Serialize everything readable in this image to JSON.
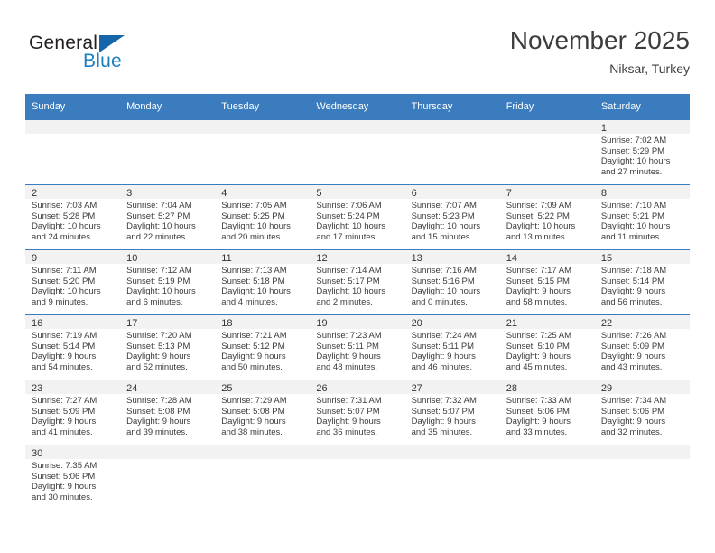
{
  "brand": {
    "word1": "General",
    "word2": "Blue",
    "flag_icon": "triangle-flag-icon",
    "color_dark": "#231f20",
    "color_blue": "#1b7fc4"
  },
  "header": {
    "month_title": "November 2025",
    "location": "Niksar, Turkey"
  },
  "theme": {
    "header_bg": "#3a7cbe",
    "cell_head_bg": "#f2f2f2",
    "grid_line": "#3a7cbe",
    "text": "#3b3b3b"
  },
  "weekday_headers": [
    "Sunday",
    "Monday",
    "Tuesday",
    "Wednesday",
    "Thursday",
    "Friday",
    "Saturday"
  ],
  "weeks": [
    [
      {
        "day": "",
        "sunrise": "",
        "sunset": "",
        "daylight1": "",
        "daylight2": "",
        "empty": true
      },
      {
        "day": "",
        "sunrise": "",
        "sunset": "",
        "daylight1": "",
        "daylight2": "",
        "empty": true
      },
      {
        "day": "",
        "sunrise": "",
        "sunset": "",
        "daylight1": "",
        "daylight2": "",
        "empty": true
      },
      {
        "day": "",
        "sunrise": "",
        "sunset": "",
        "daylight1": "",
        "daylight2": "",
        "empty": true
      },
      {
        "day": "",
        "sunrise": "",
        "sunset": "",
        "daylight1": "",
        "daylight2": "",
        "empty": true
      },
      {
        "day": "",
        "sunrise": "",
        "sunset": "",
        "daylight1": "",
        "daylight2": "",
        "empty": true
      },
      {
        "day": "1",
        "sunrise": "Sunrise: 7:02 AM",
        "sunset": "Sunset: 5:29 PM",
        "daylight1": "Daylight: 10 hours",
        "daylight2": "and 27 minutes.",
        "empty": false
      }
    ],
    [
      {
        "day": "2",
        "sunrise": "Sunrise: 7:03 AM",
        "sunset": "Sunset: 5:28 PM",
        "daylight1": "Daylight: 10 hours",
        "daylight2": "and 24 minutes.",
        "empty": false
      },
      {
        "day": "3",
        "sunrise": "Sunrise: 7:04 AM",
        "sunset": "Sunset: 5:27 PM",
        "daylight1": "Daylight: 10 hours",
        "daylight2": "and 22 minutes.",
        "empty": false
      },
      {
        "day": "4",
        "sunrise": "Sunrise: 7:05 AM",
        "sunset": "Sunset: 5:25 PM",
        "daylight1": "Daylight: 10 hours",
        "daylight2": "and 20 minutes.",
        "empty": false
      },
      {
        "day": "5",
        "sunrise": "Sunrise: 7:06 AM",
        "sunset": "Sunset: 5:24 PM",
        "daylight1": "Daylight: 10 hours",
        "daylight2": "and 17 minutes.",
        "empty": false
      },
      {
        "day": "6",
        "sunrise": "Sunrise: 7:07 AM",
        "sunset": "Sunset: 5:23 PM",
        "daylight1": "Daylight: 10 hours",
        "daylight2": "and 15 minutes.",
        "empty": false
      },
      {
        "day": "7",
        "sunrise": "Sunrise: 7:09 AM",
        "sunset": "Sunset: 5:22 PM",
        "daylight1": "Daylight: 10 hours",
        "daylight2": "and 13 minutes.",
        "empty": false
      },
      {
        "day": "8",
        "sunrise": "Sunrise: 7:10 AM",
        "sunset": "Sunset: 5:21 PM",
        "daylight1": "Daylight: 10 hours",
        "daylight2": "and 11 minutes.",
        "empty": false
      }
    ],
    [
      {
        "day": "9",
        "sunrise": "Sunrise: 7:11 AM",
        "sunset": "Sunset: 5:20 PM",
        "daylight1": "Daylight: 10 hours",
        "daylight2": "and 9 minutes.",
        "empty": false
      },
      {
        "day": "10",
        "sunrise": "Sunrise: 7:12 AM",
        "sunset": "Sunset: 5:19 PM",
        "daylight1": "Daylight: 10 hours",
        "daylight2": "and 6 minutes.",
        "empty": false
      },
      {
        "day": "11",
        "sunrise": "Sunrise: 7:13 AM",
        "sunset": "Sunset: 5:18 PM",
        "daylight1": "Daylight: 10 hours",
        "daylight2": "and 4 minutes.",
        "empty": false
      },
      {
        "day": "12",
        "sunrise": "Sunrise: 7:14 AM",
        "sunset": "Sunset: 5:17 PM",
        "daylight1": "Daylight: 10 hours",
        "daylight2": "and 2 minutes.",
        "empty": false
      },
      {
        "day": "13",
        "sunrise": "Sunrise: 7:16 AM",
        "sunset": "Sunset: 5:16 PM",
        "daylight1": "Daylight: 10 hours",
        "daylight2": "and 0 minutes.",
        "empty": false
      },
      {
        "day": "14",
        "sunrise": "Sunrise: 7:17 AM",
        "sunset": "Sunset: 5:15 PM",
        "daylight1": "Daylight: 9 hours",
        "daylight2": "and 58 minutes.",
        "empty": false
      },
      {
        "day": "15",
        "sunrise": "Sunrise: 7:18 AM",
        "sunset": "Sunset: 5:14 PM",
        "daylight1": "Daylight: 9 hours",
        "daylight2": "and 56 minutes.",
        "empty": false
      }
    ],
    [
      {
        "day": "16",
        "sunrise": "Sunrise: 7:19 AM",
        "sunset": "Sunset: 5:14 PM",
        "daylight1": "Daylight: 9 hours",
        "daylight2": "and 54 minutes.",
        "empty": false
      },
      {
        "day": "17",
        "sunrise": "Sunrise: 7:20 AM",
        "sunset": "Sunset: 5:13 PM",
        "daylight1": "Daylight: 9 hours",
        "daylight2": "and 52 minutes.",
        "empty": false
      },
      {
        "day": "18",
        "sunrise": "Sunrise: 7:21 AM",
        "sunset": "Sunset: 5:12 PM",
        "daylight1": "Daylight: 9 hours",
        "daylight2": "and 50 minutes.",
        "empty": false
      },
      {
        "day": "19",
        "sunrise": "Sunrise: 7:23 AM",
        "sunset": "Sunset: 5:11 PM",
        "daylight1": "Daylight: 9 hours",
        "daylight2": "and 48 minutes.",
        "empty": false
      },
      {
        "day": "20",
        "sunrise": "Sunrise: 7:24 AM",
        "sunset": "Sunset: 5:11 PM",
        "daylight1": "Daylight: 9 hours",
        "daylight2": "and 46 minutes.",
        "empty": false
      },
      {
        "day": "21",
        "sunrise": "Sunrise: 7:25 AM",
        "sunset": "Sunset: 5:10 PM",
        "daylight1": "Daylight: 9 hours",
        "daylight2": "and 45 minutes.",
        "empty": false
      },
      {
        "day": "22",
        "sunrise": "Sunrise: 7:26 AM",
        "sunset": "Sunset: 5:09 PM",
        "daylight1": "Daylight: 9 hours",
        "daylight2": "and 43 minutes.",
        "empty": false
      }
    ],
    [
      {
        "day": "23",
        "sunrise": "Sunrise: 7:27 AM",
        "sunset": "Sunset: 5:09 PM",
        "daylight1": "Daylight: 9 hours",
        "daylight2": "and 41 minutes.",
        "empty": false
      },
      {
        "day": "24",
        "sunrise": "Sunrise: 7:28 AM",
        "sunset": "Sunset: 5:08 PM",
        "daylight1": "Daylight: 9 hours",
        "daylight2": "and 39 minutes.",
        "empty": false
      },
      {
        "day": "25",
        "sunrise": "Sunrise: 7:29 AM",
        "sunset": "Sunset: 5:08 PM",
        "daylight1": "Daylight: 9 hours",
        "daylight2": "and 38 minutes.",
        "empty": false
      },
      {
        "day": "26",
        "sunrise": "Sunrise: 7:31 AM",
        "sunset": "Sunset: 5:07 PM",
        "daylight1": "Daylight: 9 hours",
        "daylight2": "and 36 minutes.",
        "empty": false
      },
      {
        "day": "27",
        "sunrise": "Sunrise: 7:32 AM",
        "sunset": "Sunset: 5:07 PM",
        "daylight1": "Daylight: 9 hours",
        "daylight2": "and 35 minutes.",
        "empty": false
      },
      {
        "day": "28",
        "sunrise": "Sunrise: 7:33 AM",
        "sunset": "Sunset: 5:06 PM",
        "daylight1": "Daylight: 9 hours",
        "daylight2": "and 33 minutes.",
        "empty": false
      },
      {
        "day": "29",
        "sunrise": "Sunrise: 7:34 AM",
        "sunset": "Sunset: 5:06 PM",
        "daylight1": "Daylight: 9 hours",
        "daylight2": "and 32 minutes.",
        "empty": false
      }
    ],
    [
      {
        "day": "30",
        "sunrise": "Sunrise: 7:35 AM",
        "sunset": "Sunset: 5:06 PM",
        "daylight1": "Daylight: 9 hours",
        "daylight2": "and 30 minutes.",
        "empty": false
      },
      {
        "day": "",
        "sunrise": "",
        "sunset": "",
        "daylight1": "",
        "daylight2": "",
        "empty": true
      },
      {
        "day": "",
        "sunrise": "",
        "sunset": "",
        "daylight1": "",
        "daylight2": "",
        "empty": true
      },
      {
        "day": "",
        "sunrise": "",
        "sunset": "",
        "daylight1": "",
        "daylight2": "",
        "empty": true
      },
      {
        "day": "",
        "sunrise": "",
        "sunset": "",
        "daylight1": "",
        "daylight2": "",
        "empty": true
      },
      {
        "day": "",
        "sunrise": "",
        "sunset": "",
        "daylight1": "",
        "daylight2": "",
        "empty": true
      },
      {
        "day": "",
        "sunrise": "",
        "sunset": "",
        "daylight1": "",
        "daylight2": "",
        "empty": true
      }
    ]
  ]
}
